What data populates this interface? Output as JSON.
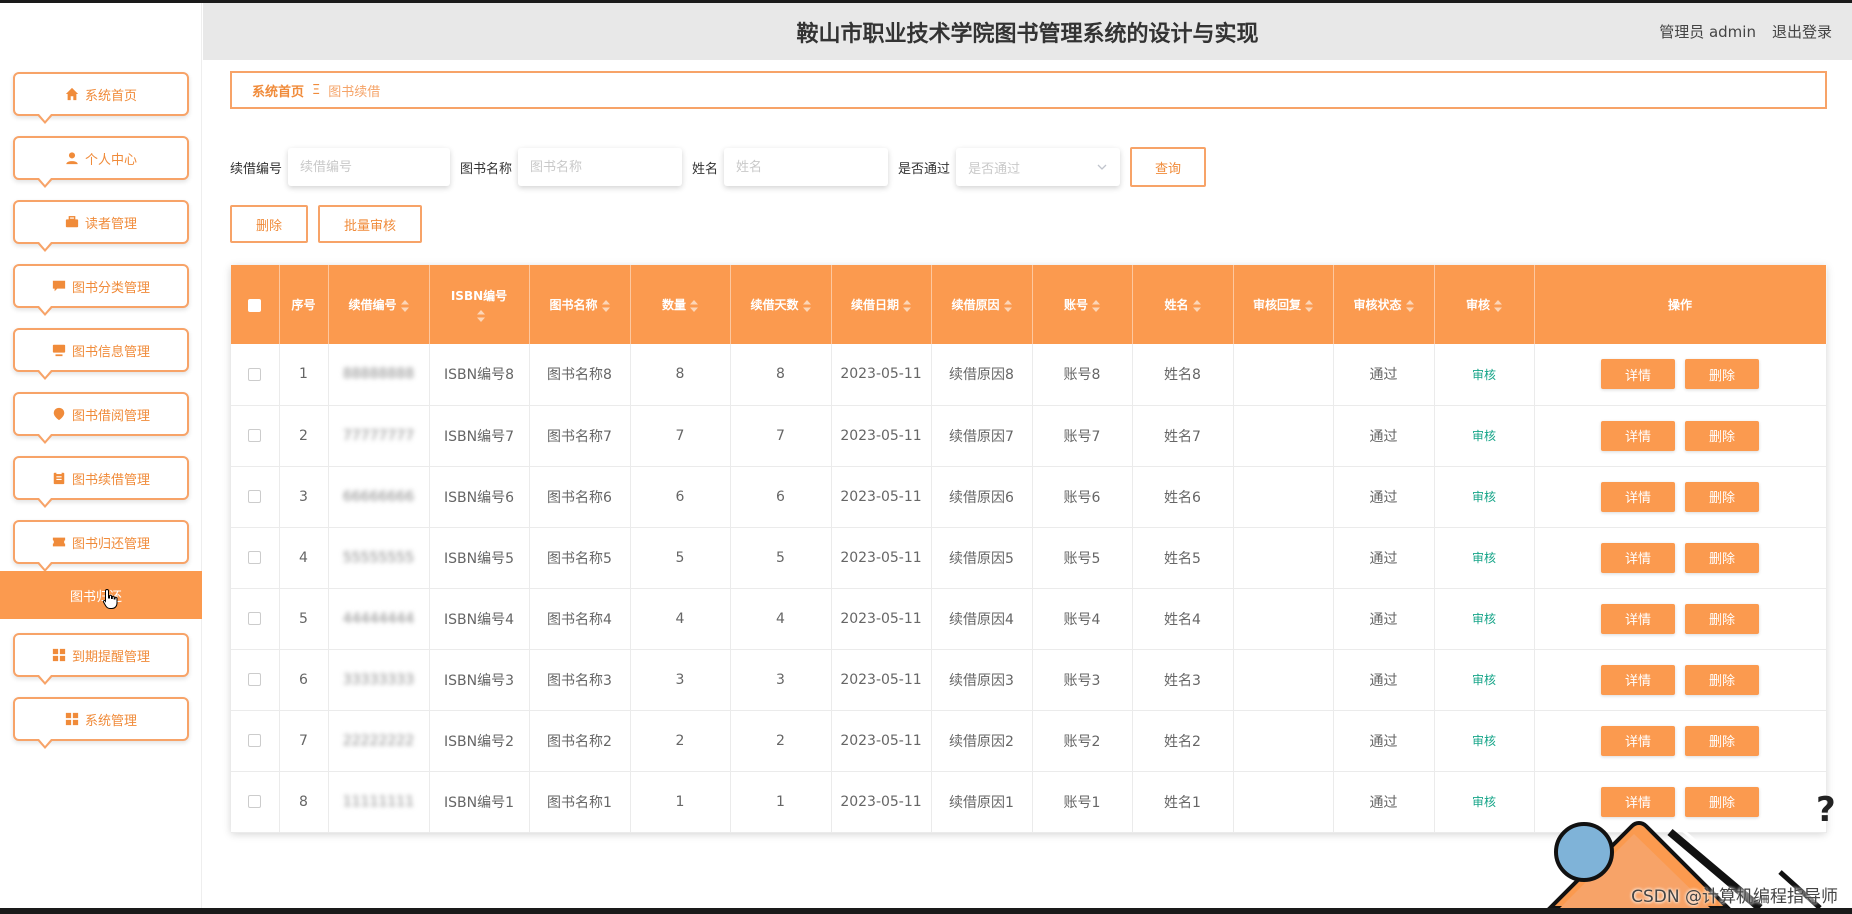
{
  "header": {
    "title": "鞍山市职业技术学院图书管理系统的设计与实现",
    "user_label": "管理员 admin",
    "logout_label": "退出登录"
  },
  "sidebar": {
    "items": [
      {
        "label": "系统首页",
        "icon": "home-icon"
      },
      {
        "label": "个人中心",
        "icon": "user-icon"
      },
      {
        "label": "读者管理",
        "icon": "briefcase-icon"
      },
      {
        "label": "图书分类管理",
        "icon": "chat-icon"
      },
      {
        "label": "图书信息管理",
        "icon": "monitor-icon"
      },
      {
        "label": "图书借阅管理",
        "icon": "pin-icon"
      },
      {
        "label": "图书续借管理",
        "icon": "clipboard-icon"
      },
      {
        "label": "图书归还管理",
        "icon": "ticket-icon"
      },
      {
        "label": "到期提醒管理",
        "icon": "grid-icon"
      },
      {
        "label": "系统管理",
        "icon": "grid-icon"
      }
    ],
    "active_sub": "图书归还"
  },
  "breadcrumb": {
    "home": "系统首页",
    "separator": "Ξ",
    "current": "图书续借"
  },
  "search": {
    "renew_no_label": "续借编号",
    "renew_no_placeholder": "续借编号",
    "book_name_label": "图书名称",
    "book_name_placeholder": "图书名称",
    "name_label": "姓名",
    "name_placeholder": "姓名",
    "passed_label": "是否通过",
    "passed_placeholder": "是否通过",
    "query_button": "查询"
  },
  "actions": {
    "delete_button": "删除",
    "batch_review_button": "批量审核"
  },
  "table": {
    "columns": [
      "序号",
      "续借编号",
      "ISBN编号",
      "图书名称",
      "数量",
      "续借天数",
      "续借日期",
      "续借原因",
      "账号",
      "姓名",
      "审核回复",
      "审核状态",
      "审核",
      "操作"
    ],
    "rows": [
      {
        "idx": "1",
        "renew_no": "88888888",
        "isbn": "ISBN编号8",
        "book": "图书名称8",
        "qty": "8",
        "days": "8",
        "date": "2023-05-11",
        "reason": "续借原因8",
        "account": "账号8",
        "name": "姓名8",
        "reply": "",
        "status": "通过",
        "review": "审核",
        "detail": "详情",
        "delete": "删除"
      },
      {
        "idx": "2",
        "renew_no": "77777777",
        "isbn": "ISBN编号7",
        "book": "图书名称7",
        "qty": "7",
        "days": "7",
        "date": "2023-05-11",
        "reason": "续借原因7",
        "account": "账号7",
        "name": "姓名7",
        "reply": "",
        "status": "通过",
        "review": "审核",
        "detail": "详情",
        "delete": "删除"
      },
      {
        "idx": "3",
        "renew_no": "66666666",
        "isbn": "ISBN编号6",
        "book": "图书名称6",
        "qty": "6",
        "days": "6",
        "date": "2023-05-11",
        "reason": "续借原因6",
        "account": "账号6",
        "name": "姓名6",
        "reply": "",
        "status": "通过",
        "review": "审核",
        "detail": "详情",
        "delete": "删除"
      },
      {
        "idx": "4",
        "renew_no": "55555555",
        "isbn": "ISBN编号5",
        "book": "图书名称5",
        "qty": "5",
        "days": "5",
        "date": "2023-05-11",
        "reason": "续借原因5",
        "account": "账号5",
        "name": "姓名5",
        "reply": "",
        "status": "通过",
        "review": "审核",
        "detail": "详情",
        "delete": "删除"
      },
      {
        "idx": "5",
        "renew_no": "44444444",
        "isbn": "ISBN编号4",
        "book": "图书名称4",
        "qty": "4",
        "days": "4",
        "date": "2023-05-11",
        "reason": "续借原因4",
        "account": "账号4",
        "name": "姓名4",
        "reply": "",
        "status": "通过",
        "review": "审核",
        "detail": "详情",
        "delete": "删除"
      },
      {
        "idx": "6",
        "renew_no": "33333333",
        "isbn": "ISBN编号3",
        "book": "图书名称3",
        "qty": "3",
        "days": "3",
        "date": "2023-05-11",
        "reason": "续借原因3",
        "account": "账号3",
        "name": "姓名3",
        "reply": "",
        "status": "通过",
        "review": "审核",
        "detail": "详情",
        "delete": "删除"
      },
      {
        "idx": "7",
        "renew_no": "22222222",
        "isbn": "ISBN编号2",
        "book": "图书名称2",
        "qty": "2",
        "days": "2",
        "date": "2023-05-11",
        "reason": "续借原因2",
        "account": "账号2",
        "name": "姓名2",
        "reply": "",
        "status": "通过",
        "review": "审核",
        "detail": "详情",
        "delete": "删除"
      },
      {
        "idx": "8",
        "renew_no": "11111111",
        "isbn": "ISBN编号1",
        "book": "图书名称1",
        "qty": "1",
        "days": "1",
        "date": "2023-05-11",
        "reason": "续借原因1",
        "account": "账号1",
        "name": "姓名1",
        "reply": "",
        "status": "通过",
        "review": "审核",
        "detail": "详情",
        "delete": "删除"
      }
    ]
  },
  "watermark": "CSDN @计算机编程指导师",
  "help_mark": "?",
  "colors": {
    "accent": "#fb9a4f",
    "accent_text": "#f08b3a",
    "review_link": "#17a589"
  }
}
